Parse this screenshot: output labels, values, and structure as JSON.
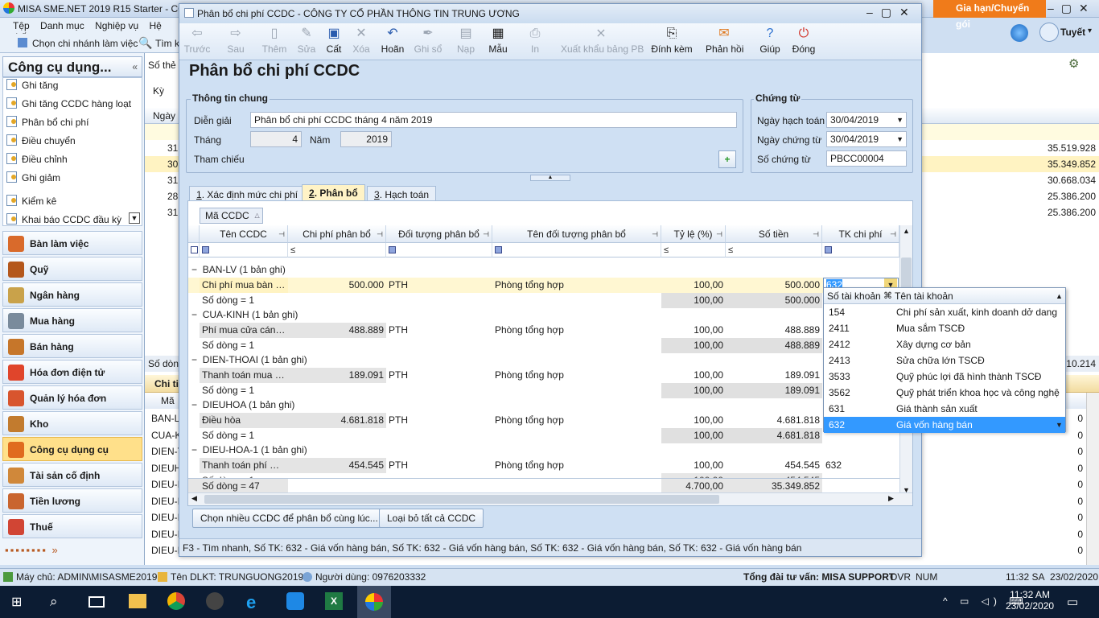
{
  "main": {
    "title": "MISA SME.NET 2019 R15 Starter - CÔN",
    "gia_han": "Gia hạn/Chuyển gói",
    "user": "Tuyết",
    "menu": [
      "Tệp",
      "Danh mục",
      "Nghiệp vụ",
      "Hệ thống"
    ],
    "chon_chi_nhanh": "Chọn chi nhánh làm việc",
    "tim": "Tìm k",
    "so_the": "Số thẻ",
    "ky": "Kỳ",
    "ngay": "Ngày h",
    "chi_tiet": "Chi ti",
    "ma_col": "Mã",
    "so_dong_bottom": "Số dòng",
    "total_right": "310.214",
    "bg_values": [
      "35.519.928",
      "35.349.852",
      "30.668.034",
      "25.386.200",
      "25.386.200"
    ],
    "bg_dates": [
      "31.",
      "30.",
      "31.",
      "28.",
      "31."
    ],
    "bg_codes": [
      "BAN-L",
      "CUA-K",
      "DIEN-T",
      "DIEUH",
      "DIEU-I",
      "DIEU-I",
      "DIEU-I",
      "DIEU-I",
      "DIEU-I"
    ],
    "bg_zero": [
      "0",
      "0",
      "0",
      "0",
      "0",
      "0",
      "0",
      "0",
      "0",
      "0"
    ]
  },
  "left": {
    "header": "Công cụ dụng...",
    "items": [
      "Ghi tăng",
      "Ghi tăng CCDC hàng loạt",
      "Phân bổ chi phí",
      "Điều chuyển",
      "Điều chỉnh",
      "Ghi giảm",
      "Kiểm kê",
      "Khai báo CCDC đầu kỳ"
    ],
    "modules": [
      "Bàn làm việc",
      "Quỹ",
      "Ngân hàng",
      "Mua hàng",
      "Bán hàng",
      "Hóa đơn điện tử",
      "Quản lý hóa đơn",
      "Kho",
      "Công cụ dụng cụ",
      "Tài sản cố định",
      "Tiền lương",
      "Thuế"
    ]
  },
  "dialog": {
    "title": "Phân bổ chi phí CCDC - CÔNG TY CỔ PHẦN THÔNG TIN TRUNG ƯƠNG",
    "toolbar": [
      "Trước",
      "Sau",
      "Thêm",
      "Sửa",
      "Cất",
      "Xóa",
      "Hoãn",
      "Ghi sổ",
      "Nạp",
      "Mẫu",
      "In",
      "Xuất khẩu bảng PB",
      "Đính kèm",
      "Phản hồi",
      "Giúp",
      "Đóng"
    ],
    "heading": "Phân bổ chi phí CCDC",
    "thong_tin_chung": "Thông tin chung",
    "dien_giai_label": "Diễn giải",
    "dien_giai": "Phân bổ chi phí CCDC tháng 4 năm 2019",
    "thang_label": "Tháng",
    "thang": "4",
    "nam_label": "Năm",
    "nam": "2019",
    "tham_chieu": "Tham chiếu",
    "chung_tu": "Chứng từ",
    "ngay_hach_toan_label": "Ngày hạch toán",
    "ngay_hach_toan": "30/04/2019",
    "ngay_chung_tu_label": "Ngày chứng từ",
    "ngay_chung_tu": "30/04/2019",
    "so_chung_tu_label": "Số chứng từ",
    "so_chung_tu": "PBCC00004",
    "tabs": [
      {
        "num": "1",
        "label": ". Xác định mức chi phí"
      },
      {
        "num": "2",
        "label": ". Phân bổ"
      },
      {
        "num": "3",
        "label": ". Hạch toán"
      }
    ],
    "group_by": "Mã CCDC",
    "columns": [
      "Tên CCDC",
      "Chi phí phân bổ",
      "Đối tượng phân bổ",
      "Tên đối tượng phân bổ",
      "Tỷ lệ (%)",
      "Số tiền",
      "TK chi phí"
    ],
    "filter_le": "≤",
    "groups": [
      {
        "header": "BAN-LV (1 bản ghi)",
        "ten": "Chi phí mua bàn là...",
        "cp": "500.000",
        "dt": "PTH",
        "ten_dt": "Phòng tổng hợp",
        "tyle": "100,00",
        "sotien": "500.000",
        "tk": "632",
        "sum_label": "Số dòng = 1",
        "sum_tyle": "100,00",
        "sum_tien": "500.000"
      },
      {
        "header": "CUA-KINH (1 bản ghi)",
        "ten": "Phí mua cửa cánh...",
        "cp": "488.889",
        "dt": "PTH",
        "ten_dt": "Phòng tổng hợp",
        "tyle": "100,00",
        "sotien": "488.889",
        "tk": "",
        "sum_label": "Số dòng = 1",
        "sum_tyle": "100,00",
        "sum_tien": "488.889"
      },
      {
        "header": "DIEN-THOAI (1 bản ghi)",
        "ten": "Thanh toán mua đi...",
        "cp": "189.091",
        "dt": "PTH",
        "ten_dt": "Phòng tổng hợp",
        "tyle": "100,00",
        "sotien": "189.091",
        "tk": "",
        "sum_label": "Số dòng = 1",
        "sum_tyle": "100,00",
        "sum_tien": "189.091"
      },
      {
        "header": "DIEUHOA (1 bản ghi)",
        "ten": "Điều hòa",
        "cp": "4.681.818",
        "dt": "PTH",
        "ten_dt": "Phòng tổng hợp",
        "tyle": "100,00",
        "sotien": "4.681.818",
        "tk": "",
        "sum_label": "Số dòng = 1",
        "sum_tyle": "100,00",
        "sum_tien": "4.681.818"
      },
      {
        "header": "DIEU-HOA-1 (1 bản ghi)",
        "ten": "Thanh toán phí mu...",
        "cp": "454.545",
        "dt": "PTH",
        "ten_dt": "Phòng tổng hợp",
        "tyle": "100,00",
        "sotien": "454.545",
        "tk": "632",
        "sum_label": "Số dòng = 1",
        "sum_tyle": "100,00",
        "sum_tien": "454.545"
      }
    ],
    "footer": {
      "label": "Số dòng = 47",
      "tyle": "4.700,00",
      "sotien": "35.349.852"
    },
    "btn_chon": "Chọn nhiều CCDC để phân bổ cùng lúc...",
    "btn_loai": "Loại bỏ tất cả CCDC",
    "hint": "F3 - Tìm nhanh, Số TK: 632 - Giá vốn hàng bán, Số TK: 632 - Giá vốn hàng bán, Số TK: 632 - Giá vốn hàng bán, Số TK: 632 - Giá vốn hàng bán",
    "tk_edit": "632",
    "dropdown": {
      "col1": "Số tài khoản",
      "col2": "Tên tài khoản",
      "rows": [
        {
          "so": "154",
          "ten": "Chi phí sản xuất, kinh doanh dở dang"
        },
        {
          "so": "2411",
          "ten": "Mua sắm TSCĐ"
        },
        {
          "so": "2412",
          "ten": "Xây dựng cơ bản"
        },
        {
          "so": "2413",
          "ten": "Sửa chữa lớn TSCĐ"
        },
        {
          "so": "3533",
          "ten": "Quỹ phúc lợi đã hình thành TSCĐ"
        },
        {
          "so": "3562",
          "ten": "Quỹ phát triển khoa học và công nghệ"
        },
        {
          "so": "631",
          "ten": "Giá thành sản xuất"
        },
        {
          "so": "632",
          "ten": "Giá vốn hàng bán"
        }
      ]
    }
  },
  "statusbar": {
    "may_chu": "Máy chủ: ADMIN\\MISASME2019",
    "ten_dlkt": "Tên DLKT: TRUNGUONG2019",
    "nguoi_dung": "Người dùng: 0976203332",
    "tong_dai": "Tổng đài tư vấn: MISA SUPPORT",
    "ovr": "OVR",
    "num": "NUM",
    "time": "11:32 SA",
    "date": "23/02/2020"
  },
  "taskbar": {
    "time": "11:32 AM",
    "date": "23/02/2020"
  }
}
